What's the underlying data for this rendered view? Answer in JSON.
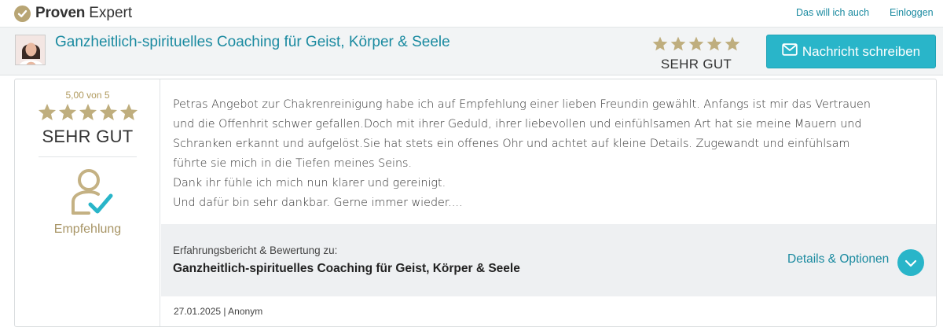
{
  "brand": {
    "name_strong": "Proven",
    "name_light": "Expert",
    "accent": "#29b5c9",
    "gold": "#b8a574",
    "icon": "check-circle-icon"
  },
  "topnav": {
    "want_label": "Das will ich auch",
    "login_label": "Einloggen"
  },
  "profile": {
    "title": "Ganzheitlich-spirituelles Coaching für Geist, Körper & Seele",
    "avatar_icon": "avatar-photo",
    "rating_label": "SEHR GUT",
    "stars": 5,
    "message_button_label": "Nachricht schreiben",
    "message_icon": "envelope-icon"
  },
  "review": {
    "score_label": "5,00 von 5",
    "stars": 5,
    "rating_label": "SEHR GUT",
    "recommend_icon": "person-check-icon",
    "recommend_label": "Empfehlung",
    "text_lines": [
      "Petras Angebot zur Chakrenreinigung habe ich auf Empfehlung einer lieben Freundin gewählt. Anfangs ist mir das Vertrauen",
      "und die Offenhrit schwer gefallen.Doch mit ihrer Geduld, ihrer liebevollen und einfühlsamen Art hat sie meine Mauern und",
      "Schranken erkannt und aufgelöst.Sie hat stets ein offenes Ohr und achtet auf kleine Details. Zugewandt und einfühlsam",
      "führte sie mich in die Tiefen meines Seins.",
      "Dank ihr fühle ich mich nun klarer und gereinigt.",
      "Und dafür bin sehr dankbar. Gerne immer wieder...."
    ],
    "details_caption": "Erfahrungsbericht & Bewertung zu:",
    "details_subject": "Ganzheitlich-spirituelles Coaching für Geist, Körper & Seele",
    "details_link": "Details & Optionen",
    "details_toggle_icon": "chevron-down-icon",
    "meta": "27.01.2025 | Anonym"
  }
}
